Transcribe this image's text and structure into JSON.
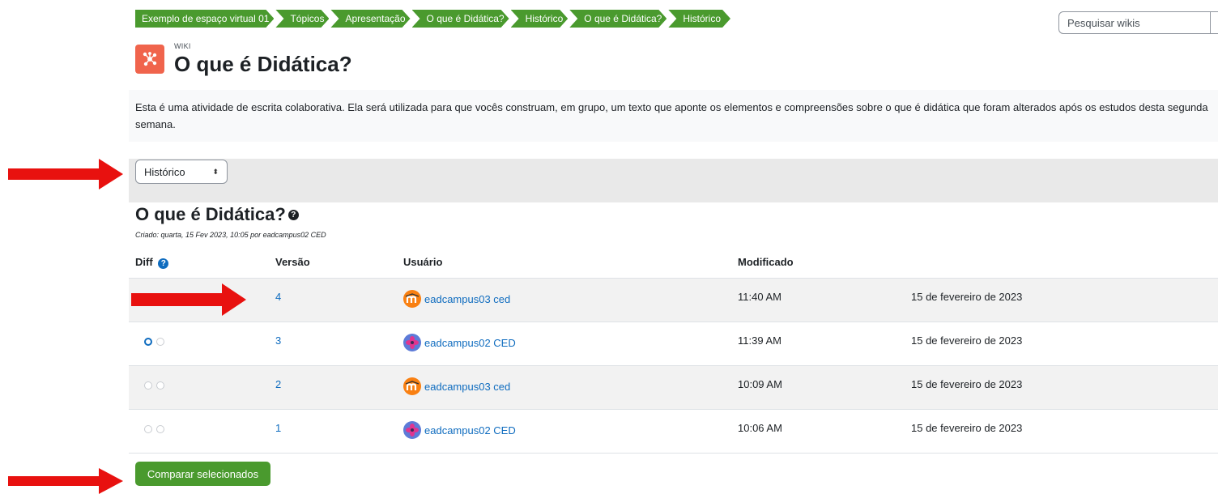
{
  "breadcrumb": [
    "Exemplo de espaço virtual 01",
    "Tópicos",
    "Apresentação",
    "O que é Didática?",
    "Histórico",
    "O que é Didática?",
    "Histórico"
  ],
  "search": {
    "placeholder": "Pesquisar wikis"
  },
  "header": {
    "module_type": "WIKI",
    "title": "O que é Didática?"
  },
  "intro": "Esta é uma atividade de escrita colaborativa. Ela será utilizada para que vocês construam, em grupo, um texto que aponte os elementos e compreensões sobre o que é didática que foram alterados após os estudos desta segunda semana.",
  "view_select": {
    "value": "Histórico"
  },
  "page": {
    "title": "O que é Didática?",
    "created": "Criado: quarta, 15 Fev 2023, 10:05 por eadcampus02 CED"
  },
  "table": {
    "headers": {
      "diff": "Diff",
      "version": "Versão",
      "user": "Usuário",
      "modified": "Modificado"
    },
    "rows": [
      {
        "version": "4",
        "user": "eadcampus03 ced",
        "time": "11:40 AM",
        "date": "15 de fevereiro de 2023",
        "avatar": "moodle-avatar",
        "radio_first": "hidden"
      },
      {
        "version": "3",
        "user": "eadcampus02 CED",
        "time": "11:39 AM",
        "date": "15 de fevereiro de 2023",
        "avatar": "flower-avatar",
        "radio_first": "checked"
      },
      {
        "version": "2",
        "user": "eadcampus03 ced",
        "time": "10:09 AM",
        "date": "15 de fevereiro de 2023",
        "avatar": "moodle-avatar",
        "radio_first": "unchecked"
      },
      {
        "version": "1",
        "user": "eadcampus02 CED",
        "time": "10:06 AM",
        "date": "15 de fevereiro de 2023",
        "avatar": "flower-avatar",
        "radio_first": "unchecked"
      }
    ]
  },
  "compare_button": "Comparar selecionados",
  "colors": {
    "green": "#4a9a2e",
    "link": "#0f6cbf",
    "wiki_icon": "#f0644c",
    "arrow": "#e8110f"
  }
}
